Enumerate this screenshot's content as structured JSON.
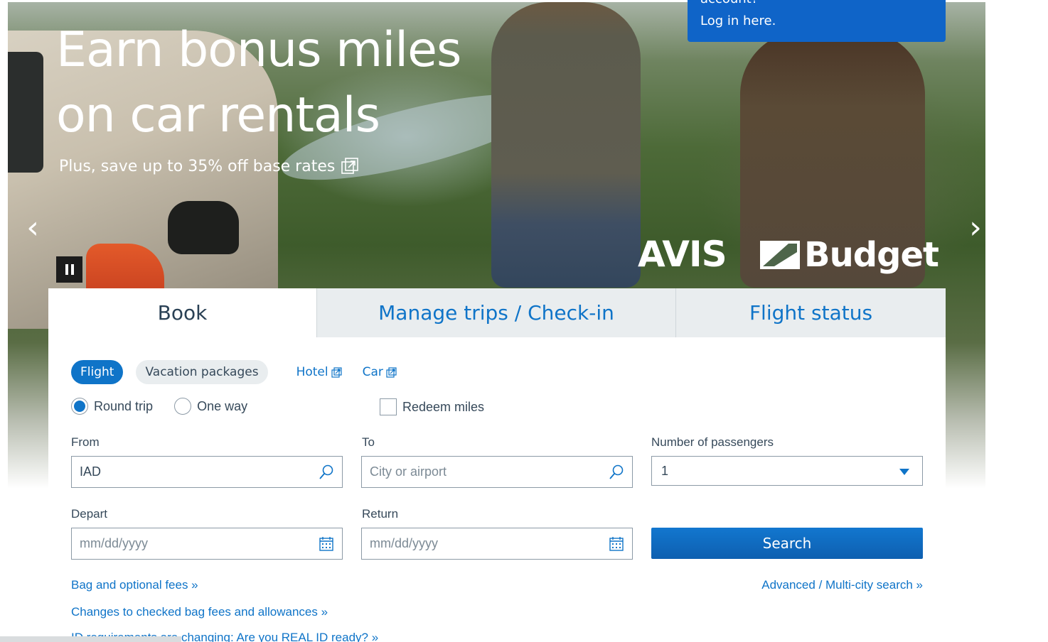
{
  "hero": {
    "title_line1": "Earn bonus miles",
    "title_line2": "on car rentals",
    "subtitle": "Plus, save up to 35% off base rates",
    "logo_avis": "AVIS",
    "logo_budget": "Budget",
    "prev_arrow": "‹",
    "next_arrow": "›"
  },
  "login_callout": {
    "line1": "account?",
    "line2": "Log in here."
  },
  "tabs": [
    {
      "label": "Book"
    },
    {
      "label": "Manage trips / Check-in"
    },
    {
      "label": "Flight status"
    }
  ],
  "booking": {
    "types": {
      "flight": "Flight",
      "vacation": "Vacation packages",
      "hotel": "Hotel",
      "car": "Car"
    },
    "trip": {
      "round_trip": "Round trip",
      "one_way": "One way",
      "redeem": "Redeem miles"
    },
    "from": {
      "label": "From",
      "value": "IAD"
    },
    "to": {
      "label": "To",
      "placeholder": "City or airport"
    },
    "passengers": {
      "label": "Number of passengers",
      "value": "1"
    },
    "depart": {
      "label": "Depart",
      "placeholder": "mm/dd/yyyy"
    },
    "return": {
      "label": "Return",
      "placeholder": "mm/dd/yyyy"
    },
    "search_label": "Search"
  },
  "links": {
    "bag_fees": "Bag and optional fees »",
    "advanced": "Advanced / Multi-city search »",
    "checked_bag": "Changes to checked bag fees and allowances »",
    "real_id": "ID requirements are changing: Are you REAL ID ready? »"
  },
  "colors": {
    "brand_blue": "#0f74c8",
    "callout_blue": "#0f64c8",
    "tab_inactive": "#e9edef"
  }
}
